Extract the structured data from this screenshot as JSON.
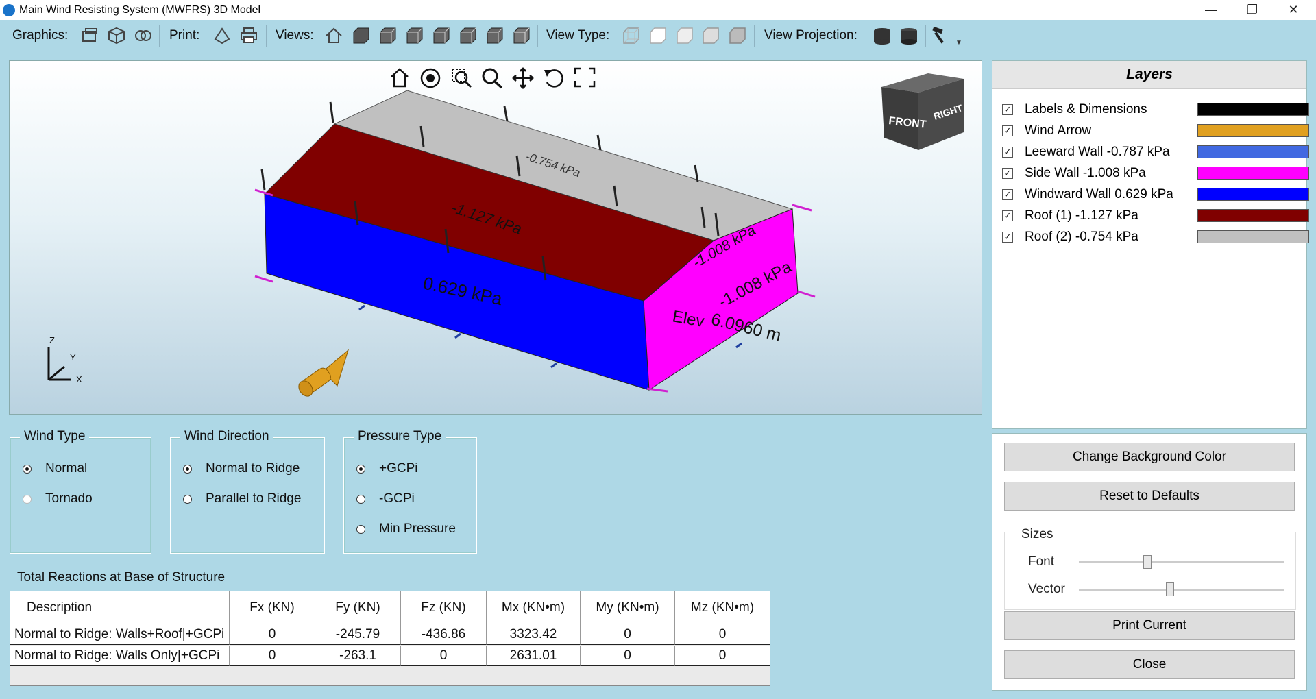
{
  "window": {
    "title": "Main Wind Resisting System (MWFRS) 3D Model",
    "controls": [
      "minimize-icon",
      "restore-icon",
      "close-icon"
    ]
  },
  "toolbar": {
    "graphics_label": "Graphics:",
    "print_label": "Print:",
    "views_label": "Views:",
    "view_type_label": "View Type:",
    "view_projection_label": "View Projection:"
  },
  "viewport": {
    "nav_icons": [
      "home-icon",
      "orbit-icon",
      "zoom-window-icon",
      "zoom-icon",
      "pan-icon",
      "rotate-icon",
      "fit-icon"
    ],
    "viewcube": {
      "front": "FRONT",
      "right": "RIGHT"
    },
    "labels": {
      "roof2": "-0.754 kPa",
      "roof1": "-1.127 kPa",
      "windward": "0.629 kPa",
      "side_top": "-1.008 kPa",
      "side": "-1.008 kPa",
      "elev": "Elev",
      "dim": "6.0960 m"
    },
    "axes": {
      "z": "Z",
      "y": "Y",
      "x": "X"
    }
  },
  "layers": {
    "title": "Layers",
    "items": [
      {
        "label": "Labels & Dimensions",
        "color": "#000000",
        "checked": true
      },
      {
        "label": "Wind Arrow",
        "color": "#e0a020",
        "checked": true
      },
      {
        "label": "Leeward Wall -0.787 kPa",
        "color": "#4169e1",
        "checked": true
      },
      {
        "label": "Side Wall -1.008 kPa",
        "color": "#ff00ff",
        "checked": true
      },
      {
        "label": "Windward Wall 0.629 kPa",
        "color": "#0000ff",
        "checked": true
      },
      {
        "label": "Roof (1) -1.127 kPa",
        "color": "#800000",
        "checked": true
      },
      {
        "label": "Roof (2) -0.754 kPa",
        "color": "#c0c0c0",
        "checked": true
      }
    ]
  },
  "controls": {
    "change_bg": "Change Background Color",
    "reset": "Reset to Defaults",
    "sizes_title": "Sizes",
    "font_label": "Font",
    "vector_label": "Vector",
    "font_value": 0.33,
    "vector_value": 0.44,
    "print_current": "Print Current",
    "close": "Close"
  },
  "wind_type": {
    "title": "Wind Type",
    "options": [
      {
        "label": "Normal",
        "selected": true,
        "enabled": true
      },
      {
        "label": "Tornado",
        "selected": false,
        "enabled": false
      }
    ]
  },
  "wind_direction": {
    "title": "Wind Direction",
    "options": [
      {
        "label": "Normal to Ridge",
        "selected": true
      },
      {
        "label": "Parallel to Ridge",
        "selected": false
      }
    ]
  },
  "pressure_type": {
    "title": "Pressure Type",
    "options": [
      {
        "label": "+GCPi",
        "selected": true
      },
      {
        "label": "-GCPi",
        "selected": false
      },
      {
        "label": "Min Pressure",
        "selected": false
      }
    ]
  },
  "reactions": {
    "title": "Total Reactions at Base of Structure",
    "columns": [
      "Description",
      "Fx (KN)",
      "Fy (KN)",
      "Fz (KN)",
      "Mx (KN•m)",
      "My (KN•m)",
      "Mz (KN•m)"
    ],
    "rows": [
      [
        "Normal to Ridge: Walls+Roof|+GCPi",
        "0",
        "-245.79",
        "-436.86",
        "3323.42",
        "0",
        "0"
      ],
      [
        "Normal to Ridge: Walls Only|+GCPi",
        "0",
        "-263.1",
        "0",
        "2631.01",
        "0",
        "0"
      ]
    ]
  }
}
